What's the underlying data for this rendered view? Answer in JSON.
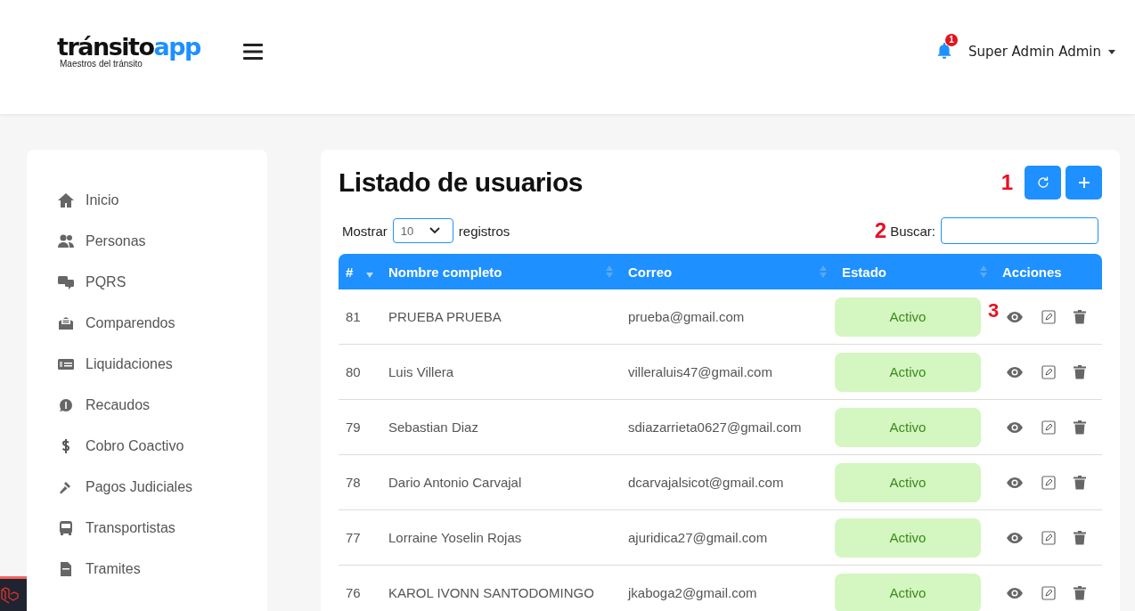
{
  "header": {
    "logo": {
      "word": "tránsito",
      "accent": "app",
      "tagline": "Maestros del tránsito"
    },
    "notifications": {
      "count": "1"
    },
    "user": {
      "name": "Super Admin Admin"
    }
  },
  "sidebar": {
    "items": [
      {
        "label": "Inicio"
      },
      {
        "label": "Personas"
      },
      {
        "label": "PQRS"
      },
      {
        "label": "Comparendos"
      },
      {
        "label": "Liquidaciones"
      },
      {
        "label": "Recaudos"
      },
      {
        "label": "Cobro Coactivo"
      },
      {
        "label": "Pagos Judiciales"
      },
      {
        "label": "Transportistas"
      },
      {
        "label": "Tramites"
      }
    ]
  },
  "main": {
    "title": "Listado de usuarios",
    "actions_marker": "1",
    "length": {
      "before": "Mostrar",
      "value": "10",
      "after": "registros"
    },
    "search": {
      "marker": "2",
      "label": "Buscar:"
    },
    "table": {
      "columns": [
        {
          "label": "#",
          "sorted": true
        },
        {
          "label": "Nombre completo",
          "sorted": false
        },
        {
          "label": "Correo",
          "sorted": false
        },
        {
          "label": "Estado",
          "sorted": false
        },
        {
          "label": "Acciones",
          "sorted": false
        }
      ],
      "rows": [
        {
          "id": "81",
          "name": "PRUEBA PRUEBA",
          "email": "prueba@gmail.com",
          "status": "Activo",
          "marker": "3"
        },
        {
          "id": "80",
          "name": "Luis Villera",
          "email": "villeraluis47@gmail.com",
          "status": "Activo"
        },
        {
          "id": "79",
          "name": "Sebastian Diaz",
          "email": "sdiazarrieta0627@gmail.com",
          "status": "Activo"
        },
        {
          "id": "78",
          "name": "Dario Antonio Carvajal",
          "email": "dcarvajalsicot@gmail.com",
          "status": "Activo"
        },
        {
          "id": "77",
          "name": "Lorraine Yoselin Rojas",
          "email": "ajuridica27@gmail.com",
          "status": "Activo"
        },
        {
          "id": "76",
          "name": "KAROL IVONN SANTODOMINGO",
          "email": "jkaboga2@gmail.com",
          "status": "Activo"
        }
      ]
    }
  }
}
